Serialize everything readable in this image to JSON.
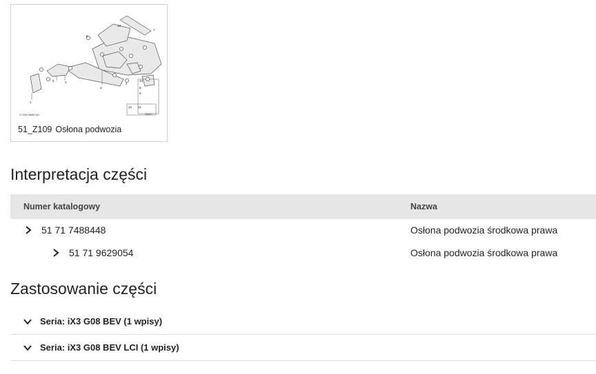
{
  "diagram": {
    "code": "51_Z109",
    "title": "Osłona podwozia",
    "copyright": "© 2020 BMW AG",
    "ref_number": "508571",
    "callouts": [
      "1",
      "2",
      "3",
      "4",
      "5",
      "6",
      "7",
      "8",
      "9",
      "10",
      "11",
      "12",
      "13"
    ]
  },
  "parts_section": {
    "heading": "Interpretacja części",
    "columns": {
      "number": "Numer katalogowy",
      "name": "Nazwa"
    },
    "rows": [
      {
        "number": "51 71 7488448",
        "name": "Osłona podwozia środkowa prawa",
        "level": 1
      },
      {
        "number": "51 71 9629054",
        "name": "Osłona podwozia środkowa prawa",
        "level": 2
      }
    ]
  },
  "usage_section": {
    "heading": "Zastosowanie części",
    "series": [
      {
        "label": "Seria: iX3 G08 BEV (1 wpisy)"
      },
      {
        "label": "Seria: iX3 G08 BEV LCI (1 wpisy)"
      }
    ]
  },
  "icons": {
    "row_expand": "chevron-right-icon",
    "series_toggle": "chevron-down-icon"
  }
}
